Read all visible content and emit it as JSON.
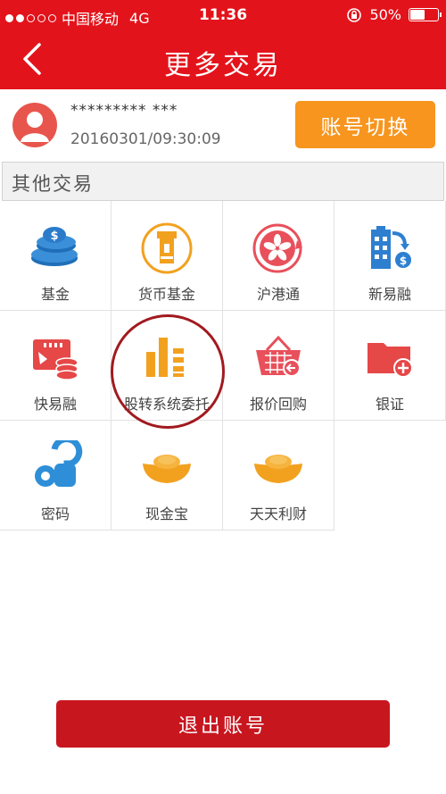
{
  "status_bar": {
    "carrier": "中国移动",
    "network": "4G",
    "time": "11:36",
    "battery": "50%",
    "signal_filled": 2,
    "signal_total": 5
  },
  "header": {
    "title": "更多交易",
    "back_icon": "chevron-left-icon"
  },
  "account": {
    "number": "********* ***",
    "timestamp": "20160301/09:30:09",
    "switch_label": "账号切换"
  },
  "section": {
    "title": "其他交易"
  },
  "grid": {
    "items": [
      {
        "label": "基金",
        "icon": "fund-coins-icon"
      },
      {
        "label": "货币基金",
        "icon": "money-fund-icon"
      },
      {
        "label": "沪港通",
        "icon": "hk-connect-icon"
      },
      {
        "label": "新易融",
        "icon": "building-finance-icon"
      },
      {
        "label": "快易融",
        "icon": "quick-finance-icon"
      },
      {
        "label": "股转系统委托",
        "icon": "stock-transfer-icon"
      },
      {
        "label": "报价回购",
        "icon": "basket-repurchase-icon"
      },
      {
        "label": "银证",
        "icon": "bank-folder-icon"
      },
      {
        "label": "密码",
        "icon": "key-icon"
      },
      {
        "label": "现金宝",
        "icon": "gold-ingot-icon"
      },
      {
        "label": "天天利财",
        "icon": "gold-ingot-icon"
      }
    ]
  },
  "logout": {
    "label": "退出账号"
  },
  "colors": {
    "brand_red": "#e3131b",
    "switch_orange": "#f7951e",
    "logout_red": "#c8161f",
    "highlight_circle": "#a11a1f"
  }
}
